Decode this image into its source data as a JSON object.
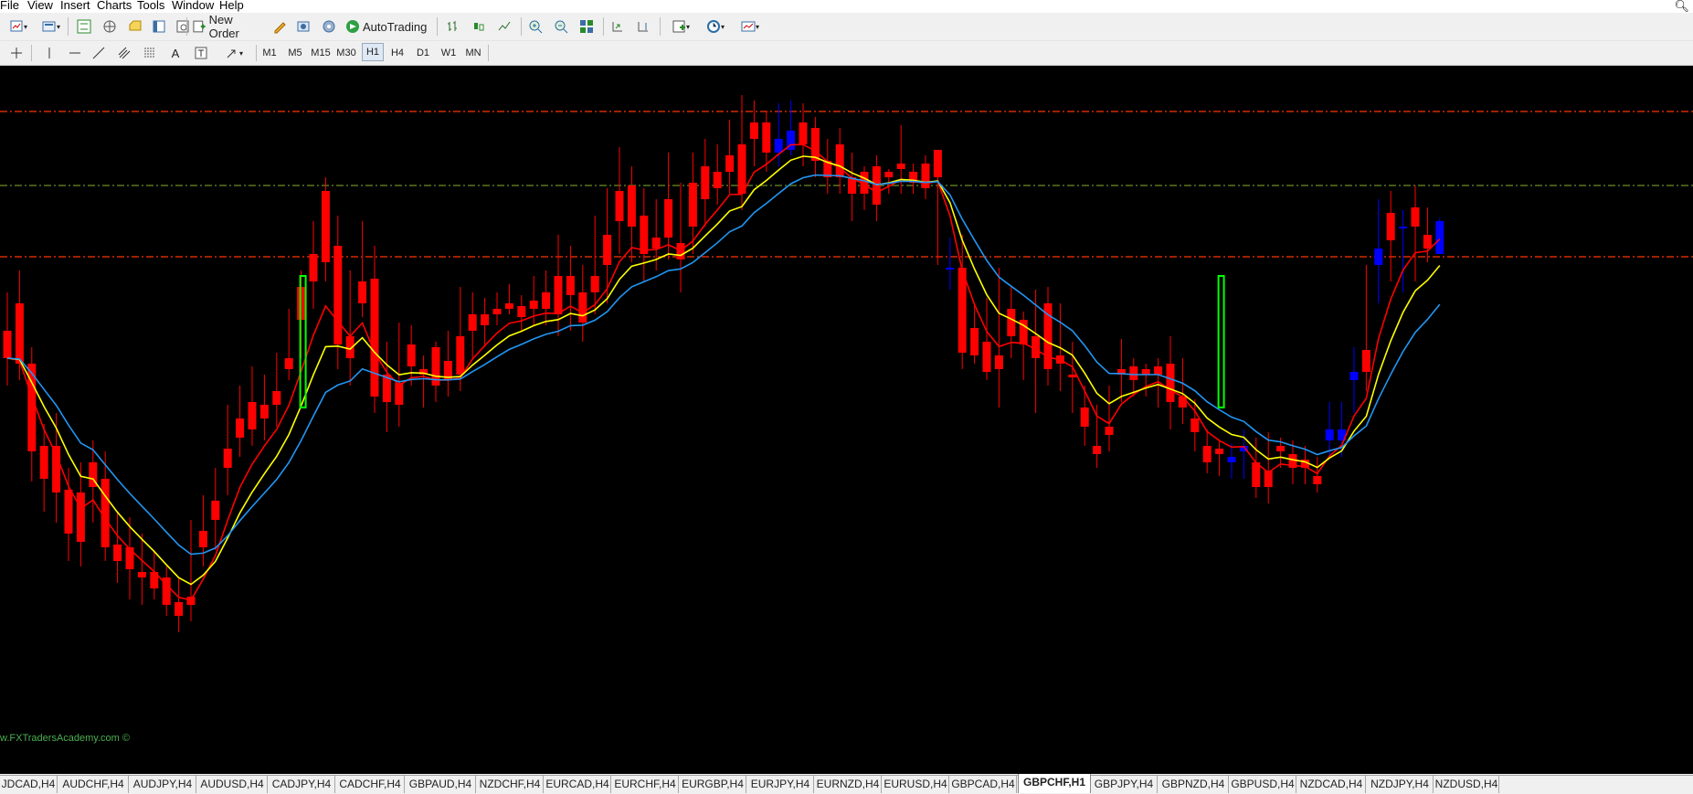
{
  "menu": [
    "File",
    "View",
    "Insert",
    "Charts",
    "Tools",
    "Window",
    "Help"
  ],
  "toolbar": {
    "new_order_label": "New Order",
    "autotrading_label": "AutoTrading",
    "icons": [
      "new-chart-icon",
      "profiles-icon",
      "market-watch-icon",
      "navigator-icon",
      "data-window-icon",
      "terminal-icon",
      "strategy-tester-icon",
      "metaeditor-icon",
      "history-center-icon",
      "options-icon",
      "bar-chart-icon",
      "candlestick-icon",
      "line-chart-icon",
      "zoom-in-icon",
      "zoom-out-icon",
      "tile-windows-icon",
      "autoscroll-icon",
      "chart-shift-icon",
      "indicators-icon",
      "periods-icon",
      "templates-icon"
    ]
  },
  "draw_tools": [
    "crosshair-icon",
    "vertical-line-icon",
    "horizontal-line-icon",
    "trendline-icon",
    "equidistant-channel-icon",
    "fibonacci-icon",
    "text-icon",
    "text-label-icon",
    "arrows-icon"
  ],
  "timeframes": [
    "M1",
    "M5",
    "M15",
    "M30",
    "H1",
    "H4",
    "D1",
    "W1",
    "MN"
  ],
  "active_timeframe": "H1",
  "watermark": "w.FXTradersAcademy.com ©",
  "tabs": [
    "JDCAD,H4",
    "AUDCHF,H4",
    "AUDJPY,H4",
    "AUDUSD,H4",
    "CADJPY,H4",
    "CADCHF,H4",
    "GBPAUD,H4",
    "NZDCHF,H4",
    "EURCAD,H4",
    "EURCHF,H4",
    "EURGBP,H4",
    "EURJPY,H4",
    "EURNZD,H4",
    "EURUSD,H4",
    "GBPCAD,H4",
    "GBPCHF,H1",
    "GBPJPY,H4",
    "GBPNZD,H4",
    "GBPUSD,H4",
    "NZDCAD,H4",
    "NZDJPY,H4",
    "NZDUSD,H4"
  ],
  "active_tab": "GBPCHF,H1",
  "colors": {
    "bull": "#0000ff",
    "bear": "#ff0000",
    "ma_fast": "#ff0000",
    "ma_mid": "#ffff00",
    "ma_slow": "#2196f3",
    "level_resistance": "#ff3300",
    "level_mid": "#6b8e23",
    "signal_bar": "#00ff00"
  },
  "chart_data": {
    "type": "candlestick",
    "symbol": "GBPCHF",
    "timeframe": "H1",
    "y_scale": "relative",
    "ylim": [
      -5,
      200
    ],
    "levels": [
      {
        "value": 190,
        "style": "dash-dot",
        "color": "#ff3300"
      },
      {
        "value": 163,
        "style": "dash-dot",
        "color": "#6b8e23"
      },
      {
        "value": 137,
        "style": "dash-dot",
        "color": "#ff3300"
      }
    ],
    "candles": [
      [
        110,
        124,
        100,
        90
      ],
      [
        120,
        132,
        98,
        92
      ],
      [
        98,
        104,
        66,
        55
      ],
      [
        68,
        76,
        56,
        44
      ],
      [
        68,
        80,
        51,
        40
      ],
      [
        52,
        60,
        36,
        26
      ],
      [
        51,
        62,
        33,
        24
      ],
      [
        62,
        70,
        53,
        40
      ],
      [
        56,
        66,
        31,
        26
      ],
      [
        32,
        44,
        26,
        18
      ],
      [
        31,
        42,
        23,
        12
      ],
      [
        22,
        36,
        20,
        10
      ],
      [
        22,
        30,
        16,
        12
      ],
      [
        20,
        24,
        10,
        6
      ],
      [
        11,
        20,
        6,
        0
      ],
      [
        13,
        41,
        10,
        4
      ],
      [
        37,
        50,
        31,
        24
      ],
      [
        48,
        60,
        41,
        30
      ],
      [
        67,
        83,
        60,
        50
      ],
      [
        78,
        90,
        71,
        64
      ],
      [
        84,
        97,
        74,
        68
      ],
      [
        83,
        94,
        78,
        70
      ],
      [
        88,
        102,
        83,
        75
      ],
      [
        100,
        118,
        96,
        92
      ],
      [
        126,
        132,
        114,
        100
      ],
      [
        138,
        150,
        128,
        118
      ],
      [
        161,
        166,
        135,
        128
      ],
      [
        141,
        152,
        105,
        96
      ],
      [
        108,
        132,
        100,
        90
      ],
      [
        128,
        150,
        120,
        115
      ],
      [
        129,
        141,
        86,
        80
      ],
      [
        94,
        106,
        84,
        73
      ],
      [
        91,
        113,
        83,
        75
      ],
      [
        105,
        112,
        97,
        90
      ],
      [
        96,
        101,
        94,
        82
      ],
      [
        104,
        106,
        90,
        84
      ],
      [
        99,
        110,
        92,
        86
      ],
      [
        108,
        126,
        94,
        88
      ],
      [
        116,
        124,
        110,
        100
      ],
      [
        116,
        122,
        112,
        104
      ],
      [
        118,
        124,
        116,
        112
      ],
      [
        120,
        127,
        118,
        116
      ],
      [
        119,
        123,
        115,
        110
      ],
      [
        121,
        130,
        118,
        112
      ],
      [
        124,
        132,
        118,
        112
      ],
      [
        130,
        145,
        116,
        108
      ],
      [
        130,
        141,
        123,
        110
      ],
      [
        124,
        134,
        113,
        106
      ],
      [
        130,
        152,
        124,
        116
      ],
      [
        145,
        162,
        134,
        120
      ],
      [
        161,
        177,
        150,
        138
      ],
      [
        163,
        170,
        148,
        135
      ],
      [
        152,
        162,
        138,
        128
      ],
      [
        144,
        158,
        140,
        132
      ],
      [
        158,
        175,
        144,
        136
      ],
      [
        142,
        164,
        136,
        124
      ],
      [
        164,
        175,
        148,
        138
      ],
      [
        170,
        180,
        158,
        148
      ],
      [
        168,
        178,
        162,
        156
      ],
      [
        174,
        187,
        168,
        160
      ],
      [
        178,
        196,
        160,
        154
      ],
      [
        186,
        194,
        180,
        170
      ],
      [
        186,
        190,
        175,
        168
      ],
      [
        175,
        193,
        180,
        170
      ],
      [
        176,
        194,
        183,
        174
      ],
      [
        186,
        193,
        178,
        170
      ],
      [
        184,
        188,
        172,
        166
      ],
      [
        172,
        180,
        166,
        160
      ],
      [
        178,
        184,
        166,
        160
      ],
      [
        166,
        175,
        160,
        150
      ],
      [
        168,
        170,
        160,
        154
      ],
      [
        170,
        174,
        156,
        150
      ],
      [
        168,
        169,
        166,
        160
      ],
      [
        171,
        185,
        169,
        160
      ],
      [
        168,
        171,
        164,
        160
      ],
      [
        171,
        174,
        162,
        158
      ],
      [
        176,
        168,
        166,
        134
      ],
      [
        133,
        144,
        133,
        125
      ],
      [
        133,
        145,
        102,
        96
      ],
      [
        111,
        120,
        101,
        98
      ],
      [
        106,
        122,
        95,
        92
      ],
      [
        101,
        133,
        96,
        82
      ],
      [
        118,
        126,
        108,
        100
      ],
      [
        114,
        117,
        105,
        92
      ],
      [
        108,
        125,
        100,
        80
      ],
      [
        120,
        126,
        96,
        90
      ],
      [
        101,
        120,
        98,
        88
      ],
      [
        94,
        106,
        93,
        80
      ],
      [
        82,
        90,
        75,
        68
      ],
      [
        68,
        83,
        65,
        60
      ],
      [
        75,
        90,
        72,
        66
      ],
      [
        96,
        107,
        94,
        84
      ],
      [
        97,
        100,
        92,
        86
      ],
      [
        96,
        98,
        94,
        86
      ],
      [
        97,
        100,
        94,
        82
      ],
      [
        98,
        108,
        84,
        74
      ],
      [
        86,
        100,
        82,
        76
      ],
      [
        78,
        85,
        73,
        66
      ],
      [
        68,
        74,
        62,
        58
      ],
      [
        67,
        70,
        65,
        57
      ],
      [
        62,
        69,
        64,
        56
      ],
      [
        66,
        74,
        68,
        56
      ],
      [
        62,
        71,
        53,
        49
      ],
      [
        59,
        73,
        53,
        47
      ],
      [
        68,
        71,
        66,
        60
      ],
      [
        65,
        70,
        60,
        54
      ],
      [
        63,
        68,
        60,
        54
      ],
      [
        57,
        64,
        54,
        51
      ],
      [
        70,
        84,
        74,
        64
      ],
      [
        70,
        84,
        74,
        64
      ],
      [
        92,
        104,
        95,
        80
      ],
      [
        103,
        134,
        95,
        88
      ],
      [
        134,
        158,
        140,
        120
      ],
      [
        153,
        161,
        143,
        128
      ],
      [
        148,
        154,
        148,
        124
      ],
      [
        155,
        163,
        148,
        128
      ],
      [
        145,
        155,
        140,
        135
      ],
      [
        138,
        151,
        150,
        148
      ]
    ],
    "series": [
      {
        "name": "",
        "color": "#ff0000"
      },
      {
        "name": "",
        "color": "#ffff00"
      },
      {
        "name": "",
        "color": "#2196f3"
      }
    ]
  }
}
